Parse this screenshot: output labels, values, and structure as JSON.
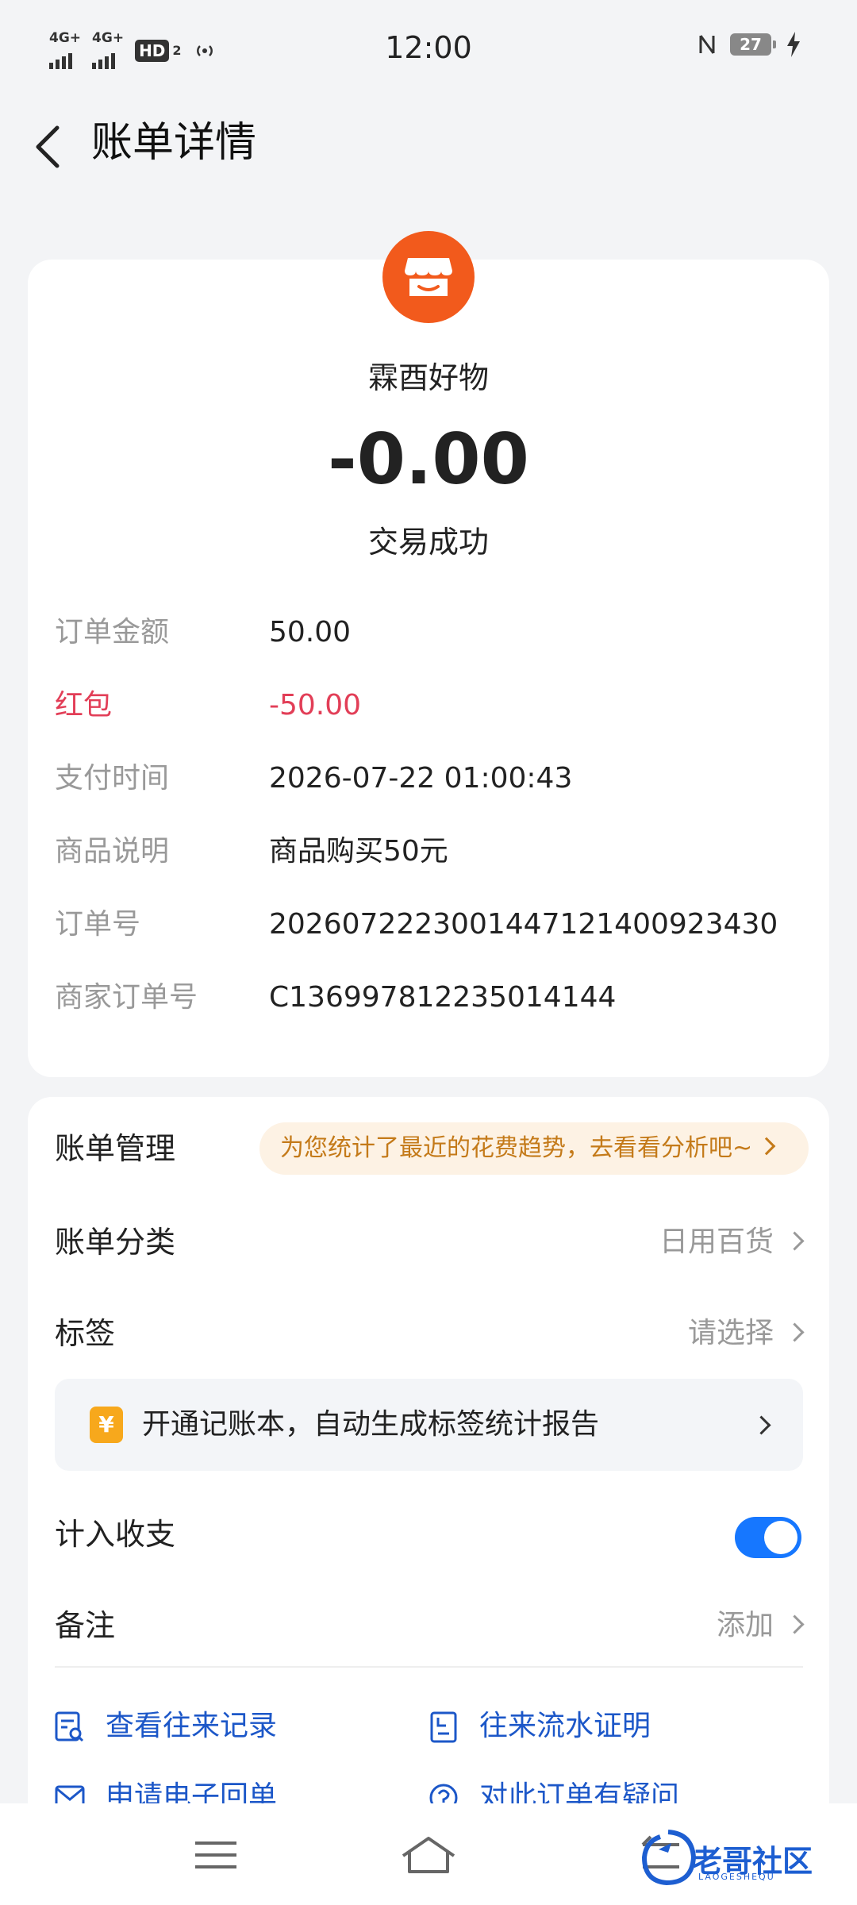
{
  "status_bar": {
    "net1": "4G+",
    "net2": "4G+",
    "hd": "HD",
    "hd_sub": "2",
    "time": "12:00",
    "battery": "27"
  },
  "header": {
    "title": "账单详情"
  },
  "bill": {
    "merchant": "霖酉好物",
    "amount": "-0.00",
    "status": "交易成功",
    "details": [
      {
        "key": "订单金额",
        "value": "50.00"
      },
      {
        "key": "红包",
        "value": "-50.00"
      },
      {
        "key": "支付时间",
        "value": "2026-07-22 01:00:43"
      },
      {
        "key": "商品说明",
        "value": "商品购买50元"
      },
      {
        "key": "订单号",
        "value": "2026072223001447121400923430"
      },
      {
        "key": "商家订单号",
        "value": "C136997812235014144"
      }
    ]
  },
  "management": {
    "title": "账单管理",
    "trend_tip": "为您统计了最近的花费趋势，去看看分析吧~",
    "category_label": "账单分类",
    "category_value": "日用百货",
    "tag_label": "标签",
    "tag_value": "请选择",
    "promo_icon": "¥",
    "promo_text": "开通记账本，自动生成标签统计报告",
    "include_label": "计入收支",
    "include_on": true,
    "note_label": "备注",
    "note_value": "添加",
    "links": [
      "查看往来记录",
      "往来流水证明",
      "申请电子回单",
      "对此订单有疑问"
    ]
  },
  "watermark": {
    "text": "老哥社区",
    "sub": "LAOGESHEQU"
  },
  "colors": {
    "accent_red": "#e23e57",
    "link_blue": "#1c57c8",
    "toggle_blue": "#1677ff",
    "merchant_orange": "#f25a1c",
    "tip_orange": "#c47a19"
  }
}
